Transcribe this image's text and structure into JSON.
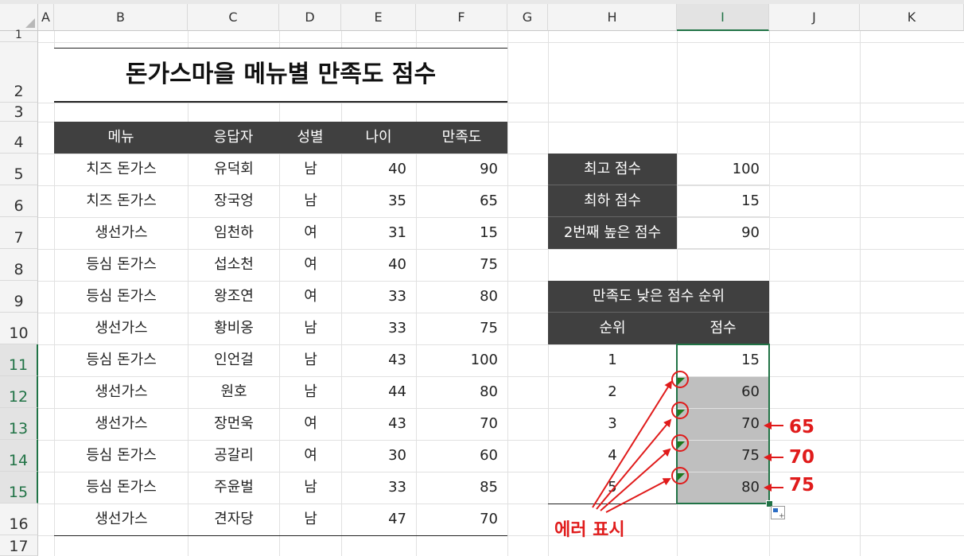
{
  "columns": [
    "A",
    "B",
    "C",
    "D",
    "E",
    "F",
    "G",
    "H",
    "I",
    "J",
    "K"
  ],
  "rows": [
    "1",
    "2",
    "3",
    "4",
    "5",
    "6",
    "7",
    "8",
    "9",
    "10",
    "11",
    "12",
    "13",
    "14",
    "15",
    "16",
    "17"
  ],
  "title": "돈가스마을 메뉴별 만족도 점수",
  "table_headers": [
    "메뉴",
    "응답자",
    "성별",
    "나이",
    "만족도"
  ],
  "table_rows": [
    [
      "치즈 돈가스",
      "유덕회",
      "남",
      "40",
      "90"
    ],
    [
      "치즈 돈가스",
      "장국엉",
      "남",
      "35",
      "65"
    ],
    [
      "생선가스",
      "임천하",
      "여",
      "31",
      "15"
    ],
    [
      "등심 돈가스",
      "섭소천",
      "여",
      "40",
      "75"
    ],
    [
      "등심 돈가스",
      "왕조연",
      "여",
      "33",
      "80"
    ],
    [
      "생선가스",
      "황비옹",
      "남",
      "33",
      "75"
    ],
    [
      "등심 돈가스",
      "인언걸",
      "남",
      "43",
      "100"
    ],
    [
      "생선가스",
      "원호",
      "남",
      "44",
      "80"
    ],
    [
      "생선가스",
      "장먼욱",
      "여",
      "43",
      "70"
    ],
    [
      "등심 돈가스",
      "공갈리",
      "여",
      "30",
      "60"
    ],
    [
      "등심 돈가스",
      "주윤벌",
      "남",
      "33",
      "85"
    ],
    [
      "생선가스",
      "견자당",
      "남",
      "47",
      "70"
    ]
  ],
  "stats": [
    {
      "label": "최고 점수",
      "value": "100"
    },
    {
      "label": "최하 점수",
      "value": "15"
    },
    {
      "label": "2번째 높은 점수",
      "value": "90"
    }
  ],
  "rank_table": {
    "title": "만족도 낮은 점수 순위",
    "headers": [
      "순위",
      "점수"
    ],
    "rows": [
      [
        "1",
        "15"
      ],
      [
        "2",
        "60"
      ],
      [
        "3",
        "70"
      ],
      [
        "4",
        "75"
      ],
      [
        "5",
        "80"
      ]
    ]
  },
  "annotations": {
    "correct_values": [
      "65",
      "70",
      "75"
    ],
    "error_label": "에러 표시"
  },
  "colors": {
    "header_bg": "#404040",
    "selection": "#217346",
    "error_triangle": "#1e7a1e",
    "annotation": "#e01b1b",
    "selected_fill": "#bfbfbf"
  }
}
